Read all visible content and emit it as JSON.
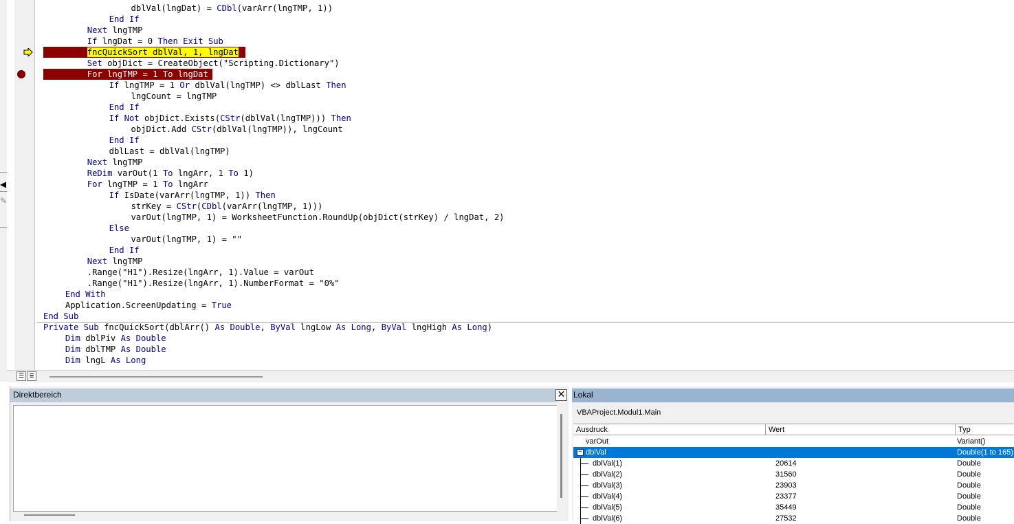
{
  "code": {
    "lines": [
      {
        "indent": 4,
        "parts": [
          [
            "t",
            "dblVal(lngDat) = "
          ],
          [
            "k",
            "CDbl"
          ],
          [
            "t",
            "(varArr(lngTMP, 1))"
          ]
        ]
      },
      {
        "indent": 3,
        "parts": [
          [
            "k",
            "End If"
          ]
        ]
      },
      {
        "indent": 2,
        "parts": [
          [
            "k",
            "Next"
          ],
          [
            "t",
            " lngTMP"
          ]
        ]
      },
      {
        "indent": 2,
        "parts": [
          [
            "k",
            "If"
          ],
          [
            "t",
            " lngDat = 0 "
          ],
          [
            "k",
            "Then Exit Sub"
          ]
        ]
      },
      {
        "indent": 2,
        "hl": "yellow",
        "parts": [
          [
            "t",
            "fncQuickSort dblVal, 1, lngDat"
          ]
        ]
      },
      {
        "indent": 2,
        "parts": [
          [
            "k",
            "Set"
          ],
          [
            "t",
            " objDict = CreateObject(\"Scripting.Dictionary\")"
          ]
        ]
      },
      {
        "indent": 2,
        "hl": "red",
        "parts": [
          [
            "t",
            "For lngTMP = 1 To lngDat"
          ]
        ]
      },
      {
        "indent": 3,
        "parts": [
          [
            "k",
            "If"
          ],
          [
            "t",
            " lngTMP = 1 "
          ],
          [
            "k",
            "Or"
          ],
          [
            "t",
            " dblVal(lngTMP) <> dblLast "
          ],
          [
            "k",
            "Then"
          ]
        ]
      },
      {
        "indent": 4,
        "parts": [
          [
            "t",
            "lngCount = lngTMP"
          ]
        ]
      },
      {
        "indent": 3,
        "parts": [
          [
            "k",
            "End If"
          ]
        ]
      },
      {
        "indent": 3,
        "parts": [
          [
            "k",
            "If Not"
          ],
          [
            "t",
            " objDict.Exists("
          ],
          [
            "k",
            "CStr"
          ],
          [
            "t",
            "(dblVal(lngTMP))) "
          ],
          [
            "k",
            "Then"
          ]
        ]
      },
      {
        "indent": 4,
        "parts": [
          [
            "t",
            "objDict.Add "
          ],
          [
            "k",
            "CStr"
          ],
          [
            "t",
            "(dblVal(lngTMP)), lngCount"
          ]
        ]
      },
      {
        "indent": 3,
        "parts": [
          [
            "k",
            "End If"
          ]
        ]
      },
      {
        "indent": 3,
        "parts": [
          [
            "t",
            "dblLast = dblVal(lngTMP)"
          ]
        ]
      },
      {
        "indent": 2,
        "parts": [
          [
            "k",
            "Next"
          ],
          [
            "t",
            " lngTMP"
          ]
        ]
      },
      {
        "indent": 2,
        "parts": [
          [
            "k",
            "ReDim"
          ],
          [
            "t",
            " varOut(1 "
          ],
          [
            "k",
            "To"
          ],
          [
            "t",
            " lngArr, 1 "
          ],
          [
            "k",
            "To"
          ],
          [
            "t",
            " 1)"
          ]
        ]
      },
      {
        "indent": 2,
        "parts": [
          [
            "k",
            "For"
          ],
          [
            "t",
            " lngTMP = 1 "
          ],
          [
            "k",
            "To"
          ],
          [
            "t",
            " lngArr"
          ]
        ]
      },
      {
        "indent": 3,
        "parts": [
          [
            "k",
            "If"
          ],
          [
            "t",
            " IsDate(varArr(lngTMP, 1)) "
          ],
          [
            "k",
            "Then"
          ]
        ]
      },
      {
        "indent": 4,
        "parts": [
          [
            "t",
            "strKey = "
          ],
          [
            "k",
            "CStr"
          ],
          [
            "t",
            "("
          ],
          [
            "k",
            "CDbl"
          ],
          [
            "t",
            "(varArr(lngTMP, 1)))"
          ]
        ]
      },
      {
        "indent": 4,
        "parts": [
          [
            "t",
            "varOut(lngTMP, 1) = WorksheetFunction.RoundUp(objDict(strKey) / lngDat, 2)"
          ]
        ]
      },
      {
        "indent": 3,
        "parts": [
          [
            "k",
            "Else"
          ]
        ]
      },
      {
        "indent": 4,
        "parts": [
          [
            "t",
            "varOut(lngTMP, 1) = \"\""
          ]
        ]
      },
      {
        "indent": 3,
        "parts": [
          [
            "k",
            "End If"
          ]
        ]
      },
      {
        "indent": 2,
        "parts": [
          [
            "k",
            "Next"
          ],
          [
            "t",
            " lngTMP"
          ]
        ]
      },
      {
        "indent": 2,
        "parts": [
          [
            "t",
            ".Range(\"H1\").Resize(lngArr, 1).Value = varOut"
          ]
        ]
      },
      {
        "indent": 2,
        "parts": [
          [
            "t",
            ".Range(\"H1\").Resize(lngArr, 1).NumberFormat = \"0%\""
          ]
        ]
      },
      {
        "indent": 1,
        "parts": [
          [
            "k",
            "End With"
          ]
        ]
      },
      {
        "indent": 1,
        "parts": [
          [
            "t",
            "Application.ScreenUpdating = "
          ],
          [
            "k",
            "True"
          ]
        ]
      },
      {
        "indent": 0,
        "parts": [
          [
            "k",
            "End Sub"
          ]
        ]
      },
      {
        "indent": 0,
        "parts": [
          [
            "k",
            "Private Sub"
          ],
          [
            "t",
            " fncQuickSort(dblArr() "
          ],
          [
            "k",
            "As Double"
          ],
          [
            "t",
            ", "
          ],
          [
            "k",
            "ByVal"
          ],
          [
            "t",
            " lngLow "
          ],
          [
            "k",
            "As Long"
          ],
          [
            "t",
            ", "
          ],
          [
            "k",
            "ByVal"
          ],
          [
            "t",
            " lngHigh "
          ],
          [
            "k",
            "As Long"
          ],
          [
            "t",
            ")"
          ]
        ]
      },
      {
        "indent": 1,
        "parts": [
          [
            "k",
            "Dim"
          ],
          [
            "t",
            " dblPiv "
          ],
          [
            "k",
            "As Double"
          ]
        ]
      },
      {
        "indent": 1,
        "parts": [
          [
            "k",
            "Dim"
          ],
          [
            "t",
            " dblTMP "
          ],
          [
            "k",
            "As Double"
          ]
        ]
      },
      {
        "indent": 1,
        "parts": [
          [
            "k",
            "Dim"
          ],
          [
            "t",
            " lngL "
          ],
          [
            "k",
            "As Long"
          ]
        ]
      }
    ],
    "keyword_color": "#00008b",
    "breakpoint_color": "#8b0000",
    "exec_color": "#ffff00"
  },
  "immediate": {
    "title": "Direktbereich"
  },
  "locals": {
    "title": "Lokal",
    "context": "VBAProject.Modul1.Main",
    "columns": [
      "Ausdruck",
      "Wert",
      "Typ"
    ],
    "rows": [
      {
        "name": "varOut",
        "value": "",
        "type": "Variant()",
        "level": 0
      },
      {
        "name": "dblVal",
        "value": "",
        "type": "Double(1 to 165)",
        "level": 0,
        "expanded": true,
        "selected": true
      },
      {
        "name": "dblVal(1)",
        "value": "20614",
        "type": "Double",
        "level": 1
      },
      {
        "name": "dblVal(2)",
        "value": "31560",
        "type": "Double",
        "level": 1
      },
      {
        "name": "dblVal(3)",
        "value": "23903",
        "type": "Double",
        "level": 1
      },
      {
        "name": "dblVal(4)",
        "value": "23377",
        "type": "Double",
        "level": 1
      },
      {
        "name": "dblVal(5)",
        "value": "35449",
        "type": "Double",
        "level": 1
      },
      {
        "name": "dblVal(6)",
        "value": "27532",
        "type": "Double",
        "level": 1
      }
    ]
  },
  "icons": [
    "execution-arrow-icon",
    "breakpoint-icon",
    "procedure-view-icon",
    "full-module-view-icon",
    "close-icon",
    "tree-collapse-icon"
  ]
}
